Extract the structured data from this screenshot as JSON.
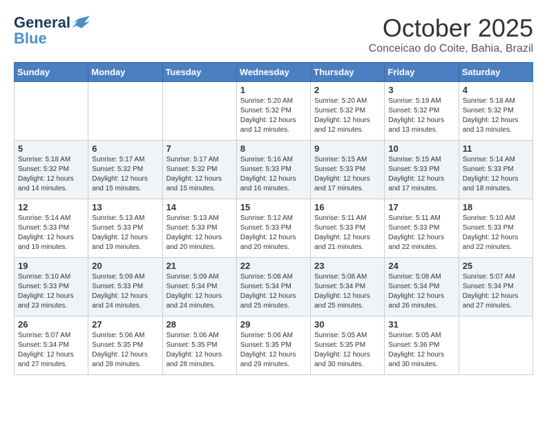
{
  "logo": {
    "line1": "General",
    "line2": "Blue"
  },
  "title": "October 2025",
  "location": "Conceicao do Coite, Bahia, Brazil",
  "weekdays": [
    "Sunday",
    "Monday",
    "Tuesday",
    "Wednesday",
    "Thursday",
    "Friday",
    "Saturday"
  ],
  "weeks": [
    [
      {
        "day": "",
        "info": ""
      },
      {
        "day": "",
        "info": ""
      },
      {
        "day": "",
        "info": ""
      },
      {
        "day": "1",
        "info": "Sunrise: 5:20 AM\nSunset: 5:32 PM\nDaylight: 12 hours\nand 12 minutes."
      },
      {
        "day": "2",
        "info": "Sunrise: 5:20 AM\nSunset: 5:32 PM\nDaylight: 12 hours\nand 12 minutes."
      },
      {
        "day": "3",
        "info": "Sunrise: 5:19 AM\nSunset: 5:32 PM\nDaylight: 12 hours\nand 13 minutes."
      },
      {
        "day": "4",
        "info": "Sunrise: 5:18 AM\nSunset: 5:32 PM\nDaylight: 12 hours\nand 13 minutes."
      }
    ],
    [
      {
        "day": "5",
        "info": "Sunrise: 5:18 AM\nSunset: 5:32 PM\nDaylight: 12 hours\nand 14 minutes."
      },
      {
        "day": "6",
        "info": "Sunrise: 5:17 AM\nSunset: 5:32 PM\nDaylight: 12 hours\nand 15 minutes."
      },
      {
        "day": "7",
        "info": "Sunrise: 5:17 AM\nSunset: 5:32 PM\nDaylight: 12 hours\nand 15 minutes."
      },
      {
        "day": "8",
        "info": "Sunrise: 5:16 AM\nSunset: 5:33 PM\nDaylight: 12 hours\nand 16 minutes."
      },
      {
        "day": "9",
        "info": "Sunrise: 5:15 AM\nSunset: 5:33 PM\nDaylight: 12 hours\nand 17 minutes."
      },
      {
        "day": "10",
        "info": "Sunrise: 5:15 AM\nSunset: 5:33 PM\nDaylight: 12 hours\nand 17 minutes."
      },
      {
        "day": "11",
        "info": "Sunrise: 5:14 AM\nSunset: 5:33 PM\nDaylight: 12 hours\nand 18 minutes."
      }
    ],
    [
      {
        "day": "12",
        "info": "Sunrise: 5:14 AM\nSunset: 5:33 PM\nDaylight: 12 hours\nand 19 minutes."
      },
      {
        "day": "13",
        "info": "Sunrise: 5:13 AM\nSunset: 5:33 PM\nDaylight: 12 hours\nand 19 minutes."
      },
      {
        "day": "14",
        "info": "Sunrise: 5:13 AM\nSunset: 5:33 PM\nDaylight: 12 hours\nand 20 minutes."
      },
      {
        "day": "15",
        "info": "Sunrise: 5:12 AM\nSunset: 5:33 PM\nDaylight: 12 hours\nand 20 minutes."
      },
      {
        "day": "16",
        "info": "Sunrise: 5:11 AM\nSunset: 5:33 PM\nDaylight: 12 hours\nand 21 minutes."
      },
      {
        "day": "17",
        "info": "Sunrise: 5:11 AM\nSunset: 5:33 PM\nDaylight: 12 hours\nand 22 minutes."
      },
      {
        "day": "18",
        "info": "Sunrise: 5:10 AM\nSunset: 5:33 PM\nDaylight: 12 hours\nand 22 minutes."
      }
    ],
    [
      {
        "day": "19",
        "info": "Sunrise: 5:10 AM\nSunset: 5:33 PM\nDaylight: 12 hours\nand 23 minutes."
      },
      {
        "day": "20",
        "info": "Sunrise: 5:09 AM\nSunset: 5:33 PM\nDaylight: 12 hours\nand 24 minutes."
      },
      {
        "day": "21",
        "info": "Sunrise: 5:09 AM\nSunset: 5:34 PM\nDaylight: 12 hours\nand 24 minutes."
      },
      {
        "day": "22",
        "info": "Sunrise: 5:08 AM\nSunset: 5:34 PM\nDaylight: 12 hours\nand 25 minutes."
      },
      {
        "day": "23",
        "info": "Sunrise: 5:08 AM\nSunset: 5:34 PM\nDaylight: 12 hours\nand 25 minutes."
      },
      {
        "day": "24",
        "info": "Sunrise: 5:08 AM\nSunset: 5:34 PM\nDaylight: 12 hours\nand 26 minutes."
      },
      {
        "day": "25",
        "info": "Sunrise: 5:07 AM\nSunset: 5:34 PM\nDaylight: 12 hours\nand 27 minutes."
      }
    ],
    [
      {
        "day": "26",
        "info": "Sunrise: 5:07 AM\nSunset: 5:34 PM\nDaylight: 12 hours\nand 27 minutes."
      },
      {
        "day": "27",
        "info": "Sunrise: 5:06 AM\nSunset: 5:35 PM\nDaylight: 12 hours\nand 28 minutes."
      },
      {
        "day": "28",
        "info": "Sunrise: 5:06 AM\nSunset: 5:35 PM\nDaylight: 12 hours\nand 28 minutes."
      },
      {
        "day": "29",
        "info": "Sunrise: 5:06 AM\nSunset: 5:35 PM\nDaylight: 12 hours\nand 29 minutes."
      },
      {
        "day": "30",
        "info": "Sunrise: 5:05 AM\nSunset: 5:35 PM\nDaylight: 12 hours\nand 30 minutes."
      },
      {
        "day": "31",
        "info": "Sunrise: 5:05 AM\nSunset: 5:36 PM\nDaylight: 12 hours\nand 30 minutes."
      },
      {
        "day": "",
        "info": ""
      }
    ]
  ]
}
